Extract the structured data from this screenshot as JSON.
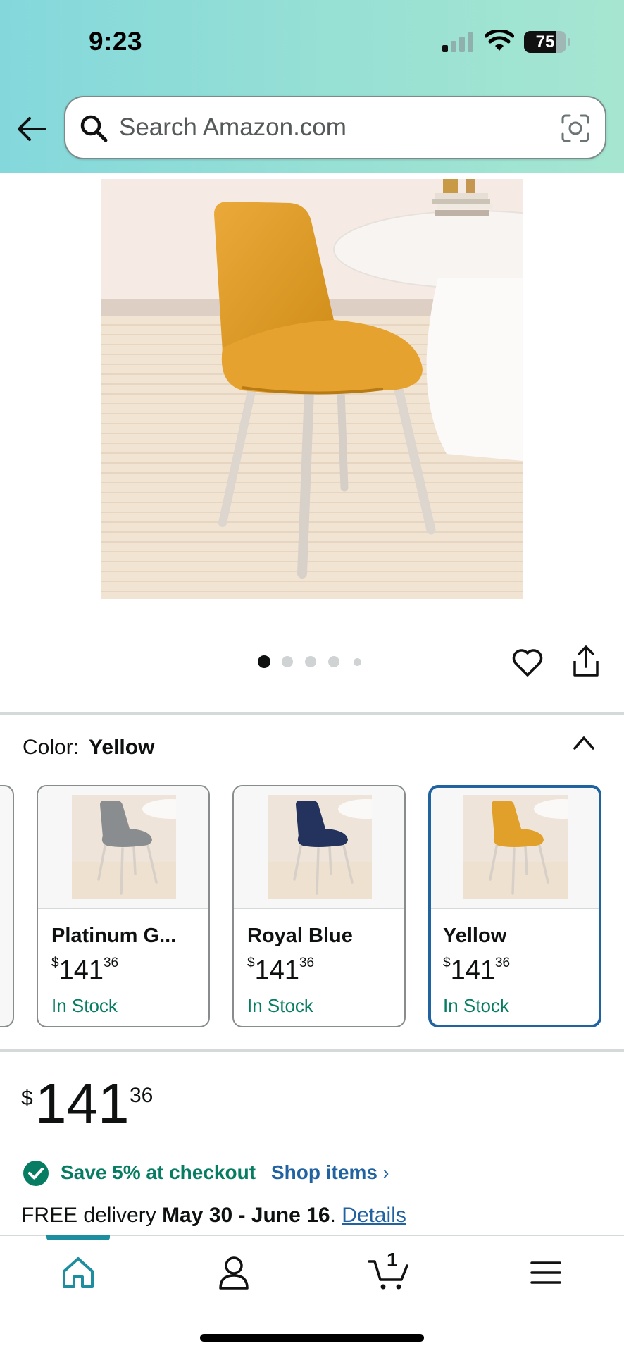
{
  "status_bar": {
    "time": "9:23",
    "battery_level": "75",
    "battery_fraction": 0.75
  },
  "search": {
    "placeholder": "Search Amazon.com"
  },
  "icons": {
    "back": "back-arrow-icon",
    "search": "search-icon",
    "camera": "camera-scan-icon",
    "wishlist": "heart-icon",
    "share": "share-icon",
    "collapse": "chevron-up-icon",
    "check": "check-circle-icon"
  },
  "gallery": {
    "image_count": 5,
    "active_index": 0
  },
  "color_selector": {
    "label": "Color:",
    "selected_value": "Yellow",
    "options": [
      {
        "name": "Platinum G...",
        "currency": "$",
        "whole": "141",
        "cents": "36",
        "stock": "In Stock",
        "seat_color": "#8a8d90"
      },
      {
        "name": "Royal Blue",
        "currency": "$",
        "whole": "141",
        "cents": "36",
        "stock": "In Stock",
        "seat_color": "#23335e"
      },
      {
        "name": "Yellow",
        "currency": "$",
        "whole": "141",
        "cents": "36",
        "stock": "In Stock",
        "seat_color": "#e0a02a"
      }
    ]
  },
  "price": {
    "currency": "$",
    "whole": "141",
    "cents": "36"
  },
  "offer": {
    "save_text": "Save 5% at checkout",
    "shop_link": "Shop items",
    "chevron": "›"
  },
  "delivery": {
    "prefix": "FREE delivery ",
    "dates": "May 30 - June 16",
    "suffix": ". ",
    "details_link": "Details"
  },
  "bottom_nav": {
    "items": [
      "home-icon",
      "account-icon",
      "cart-icon",
      "menu-icon"
    ],
    "cart_count": "1"
  },
  "colors": {
    "header_gradient_start": "#84d8dc",
    "header_gradient_end": "#a6e6d1",
    "link_blue": "#2162a1",
    "stock_green": "#067d62",
    "nav_accent": "#1d8ea0",
    "selected_border": "#2162a1"
  }
}
